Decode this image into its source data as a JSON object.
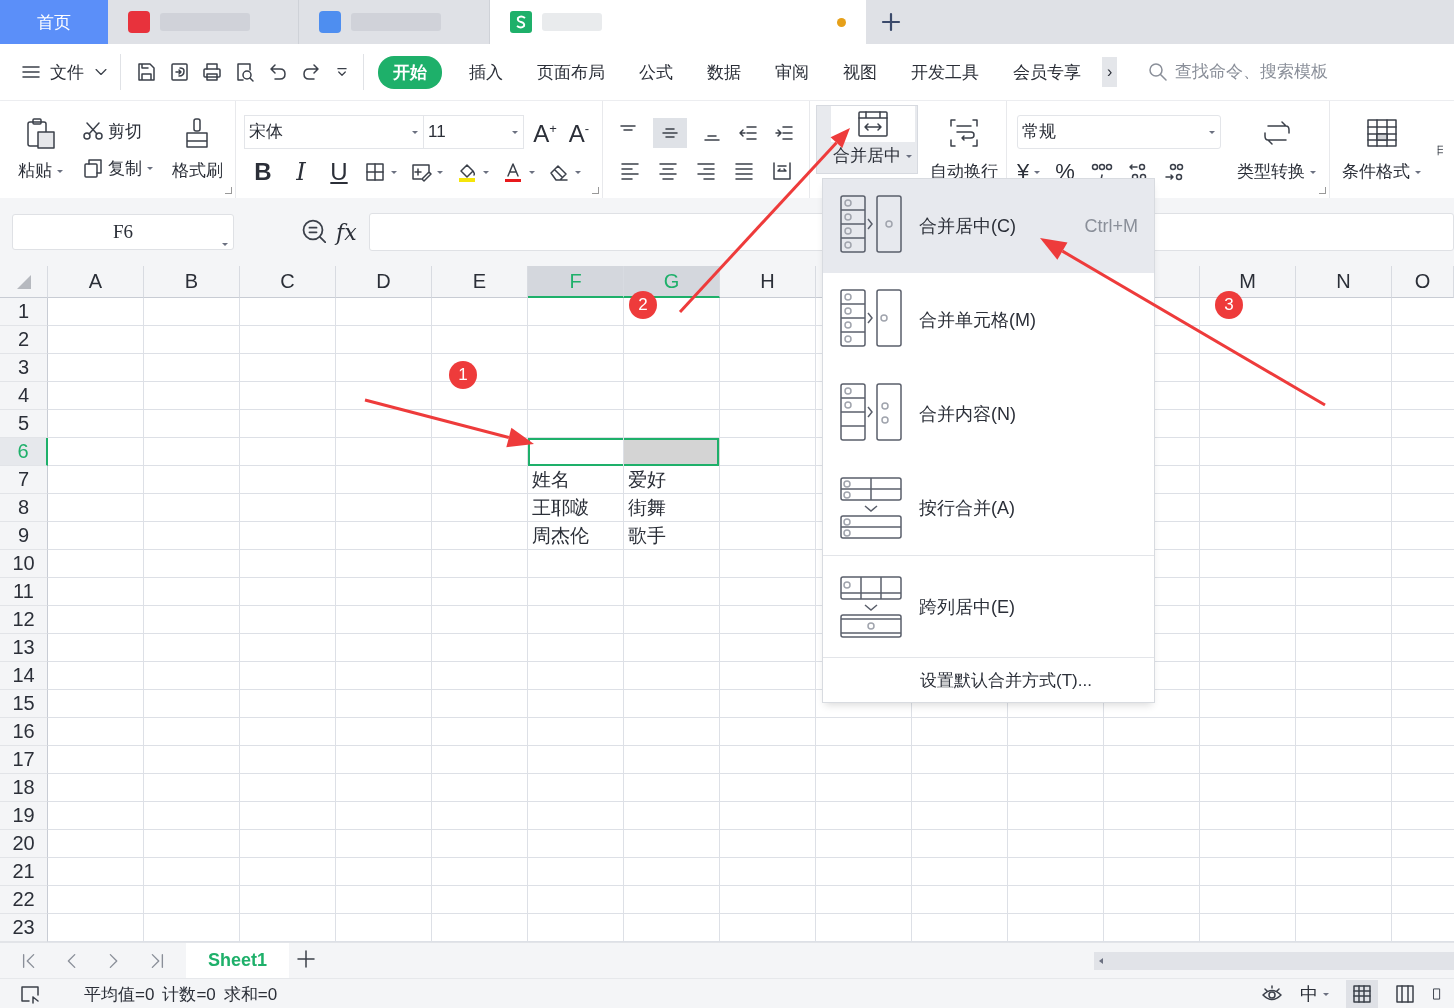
{
  "window_tabs": [
    {
      "kind": "home",
      "label": "首页",
      "selected": false
    },
    {
      "kind": "blurred",
      "selected": false
    },
    {
      "kind": "blurred",
      "selected": false
    },
    {
      "kind": "document",
      "selected": true,
      "modified": true
    }
  ],
  "menu": {
    "file": "文件",
    "tabs": [
      {
        "label": "开始",
        "selected": true
      },
      {
        "label": "插入",
        "selected": false
      },
      {
        "label": "页面布局",
        "selected": false
      },
      {
        "label": "公式",
        "selected": false
      },
      {
        "label": "数据",
        "selected": false
      },
      {
        "label": "审阅",
        "selected": false
      },
      {
        "label": "视图",
        "selected": false
      },
      {
        "label": "开发工具",
        "selected": false
      },
      {
        "label": "会员专享",
        "selected": false
      }
    ],
    "more": "›",
    "search": {
      "placeholder": "查找命令、搜索模板"
    }
  },
  "ribbon": {
    "paste": "粘贴",
    "cut": "剪切",
    "copy": "复制",
    "format_painter": "格式刷",
    "font": "宋体",
    "font_size": "11",
    "grow": "A$^{+}$",
    "shrink": "A$^{-}$",
    "bold": "B",
    "italic": "I",
    "underline": "U",
    "merge": {
      "label": "合并居中",
      "pressed": true
    },
    "wrap": "自动换行",
    "number_format": "常规",
    "currency": "¥",
    "percent": "%",
    "type_convert": "类型转换",
    "conditional": "条件格式"
  },
  "name_box": "F6",
  "fx": "fx",
  "columns": [
    {
      "kind": "header",
      "label": "A",
      "selected": false
    },
    {
      "kind": "header",
      "label": "B",
      "selected": false
    },
    {
      "kind": "header",
      "label": "C",
      "selected": false
    },
    {
      "kind": "header",
      "label": "D",
      "selected": false
    },
    {
      "kind": "header",
      "label": "E",
      "selected": false
    },
    {
      "kind": "header",
      "label": "F",
      "selected": true
    },
    {
      "kind": "header",
      "label": "G",
      "selected": true
    },
    {
      "kind": "header",
      "label": "H",
      "selected": false
    },
    {
      "kind": "covered"
    },
    {
      "kind": "covered"
    },
    {
      "kind": "covered"
    },
    {
      "kind": "covered"
    },
    {
      "kind": "header",
      "label": "M",
      "selected": false
    },
    {
      "kind": "header",
      "label": "N",
      "selected": false
    },
    {
      "kind": "header",
      "label": "O",
      "selected": false
    }
  ],
  "rows": [
    {
      "label": "1",
      "selected": false
    },
    {
      "label": "2",
      "selected": false
    },
    {
      "label": "3",
      "selected": false
    },
    {
      "label": "4",
      "selected": false
    },
    {
      "label": "5",
      "selected": false
    },
    {
      "label": "6",
      "selected": true
    },
    {
      "label": "7",
      "selected": false,
      "cells": [
        "姓名",
        "爱好"
      ]
    },
    {
      "label": "8",
      "selected": false,
      "cells": [
        "王耶啵",
        "街舞"
      ]
    },
    {
      "label": "9",
      "selected": false,
      "cells": [
        "周杰伦",
        "歌手"
      ]
    },
    {
      "label": "10",
      "selected": false
    },
    {
      "label": "11",
      "selected": false
    },
    {
      "label": "12",
      "selected": false
    },
    {
      "label": "13",
      "selected": false
    },
    {
      "label": "14",
      "selected": false
    },
    {
      "label": "15",
      "selected": false
    },
    {
      "label": "16",
      "selected": false
    },
    {
      "label": "17",
      "selected": false
    },
    {
      "label": "18",
      "selected": false
    },
    {
      "label": "19",
      "selected": false
    },
    {
      "label": "20",
      "selected": false
    },
    {
      "label": "21",
      "selected": false
    },
    {
      "label": "22",
      "selected": false
    },
    {
      "label": "23",
      "selected": false
    }
  ],
  "merge_menu": {
    "items": [
      {
        "kind": "merge_center",
        "label": "合并居中(C)",
        "shortcut": "Ctrl+M",
        "selected": true,
        "divider_above": false
      },
      {
        "kind": "merge_cells",
        "label": "合并单元格(M)",
        "selected": false,
        "divider_above": false
      },
      {
        "kind": "merge_content",
        "label": "合并内容(N)",
        "selected": false,
        "divider_above": false
      },
      {
        "kind": "merge_rows",
        "label": "按行合并(A)",
        "selected": false,
        "divider_above": false
      },
      {
        "kind": "center_across",
        "label": "跨列居中(E)",
        "selected": false,
        "divider_above": true
      }
    ],
    "footer": "设置默认合并方式(T)..."
  },
  "sheets": [
    {
      "label": "Sheet1",
      "selected": true
    }
  ],
  "status": [
    "平均值=0",
    "计数=0",
    "求和=0"
  ],
  "input_method": "中",
  "annotations": [
    {
      "label": "1"
    },
    {
      "label": "2"
    },
    {
      "label": "3"
    }
  ]
}
